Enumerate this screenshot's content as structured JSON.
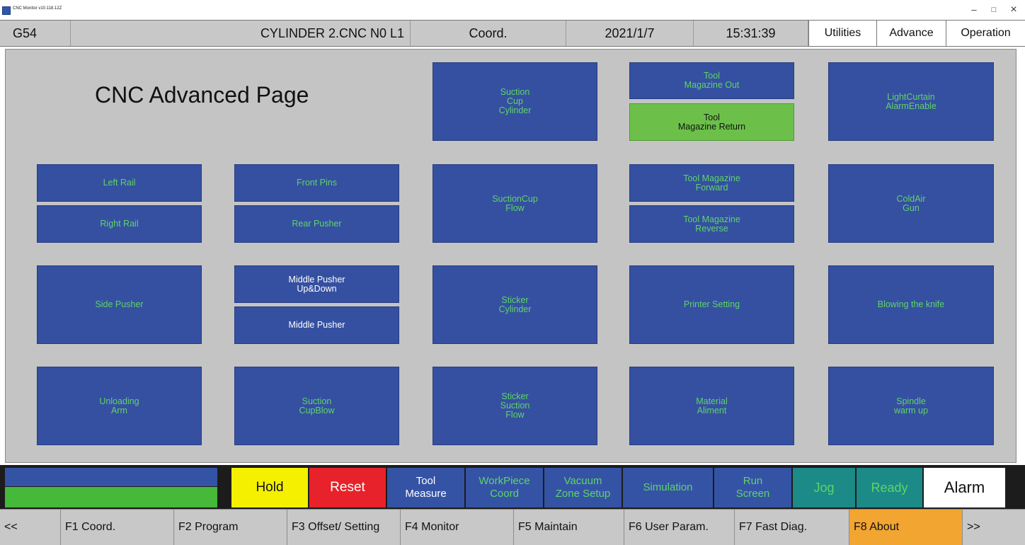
{
  "window": {
    "title": "CNC Monitor v10.118.12Z",
    "minimize": "–",
    "maximize": "□",
    "close": "×"
  },
  "status": {
    "coord_system": "G54",
    "program": "CYLINDER 2.CNC N0 L1",
    "mode": "Coord.",
    "date": "2021/1/7",
    "time": "15:31:39",
    "tabs": [
      "Utilities",
      "Advance",
      "Operation"
    ]
  },
  "page": {
    "title": "CNC Advanced Page",
    "buttons": {
      "suction_cup_cylinder": "Suction\nCup\nCylinder",
      "tool_magazine_out": "Tool\nMagazine Out",
      "tool_magazine_return": "Tool\nMagazine Return",
      "lightcurtain_alarm": "LightCurtain\nAlarmEnable",
      "left_rail": "Left Rail",
      "right_rail": "Right Rail",
      "front_pins": "Front Pins",
      "rear_pusher": "Rear Pusher",
      "suctioncup_flow": "SuctionCup\nFlow",
      "tool_magazine_forward": "Tool Magazine\nForward",
      "tool_magazine_reverse": "Tool Magazine\nReverse",
      "coldair_gun": "ColdAir\nGun",
      "side_pusher": "Side Pusher",
      "middle_pusher_updown": "Middle Pusher\nUp&Down",
      "middle_pusher": "Middle Pusher",
      "sticker_cylinder": "Sticker\nCylinder",
      "printer_setting": "Printer Setting",
      "blowing_knife": "Blowing the knife",
      "unloading_arm": "Unloading\nArm",
      "suction_cupblow": "Suction\nCupBlow",
      "sticker_suction_flow": "Sticker\nSuction\nFlow",
      "material_aliment": "Material\nAliment",
      "spindle_warm_up": "Spindle\nwarm up"
    }
  },
  "actions": {
    "hold": "Hold",
    "reset": "Reset",
    "tool_measure": "Tool\nMeasure",
    "workpiece_coord": "WorkPiece\nCoord",
    "vacuum_zone": "Vacuum\nZone Setup",
    "simulation": "Simulation",
    "run_screen": "Run\nScreen",
    "jog": "Jog",
    "ready": "Ready",
    "alarm": "Alarm"
  },
  "fkeys": [
    "<<",
    "F1 Coord.",
    "F2 Program",
    "F3 Offset/ Setting",
    "F4 Monitor",
    "F5 Maintain",
    "F6 User Param.",
    "F7 Fast Diag.",
    "F8 About",
    ">>"
  ],
  "colors": {
    "panel_bg": "#c4c4c4",
    "button_blue": "#3550a0",
    "button_text_green": "#5fd36a",
    "active_green": "#6cc04a",
    "hold_yellow": "#f4f000",
    "reset_red": "#e8222a",
    "teal": "#1c8a86",
    "f8_orange": "#f2a530"
  }
}
